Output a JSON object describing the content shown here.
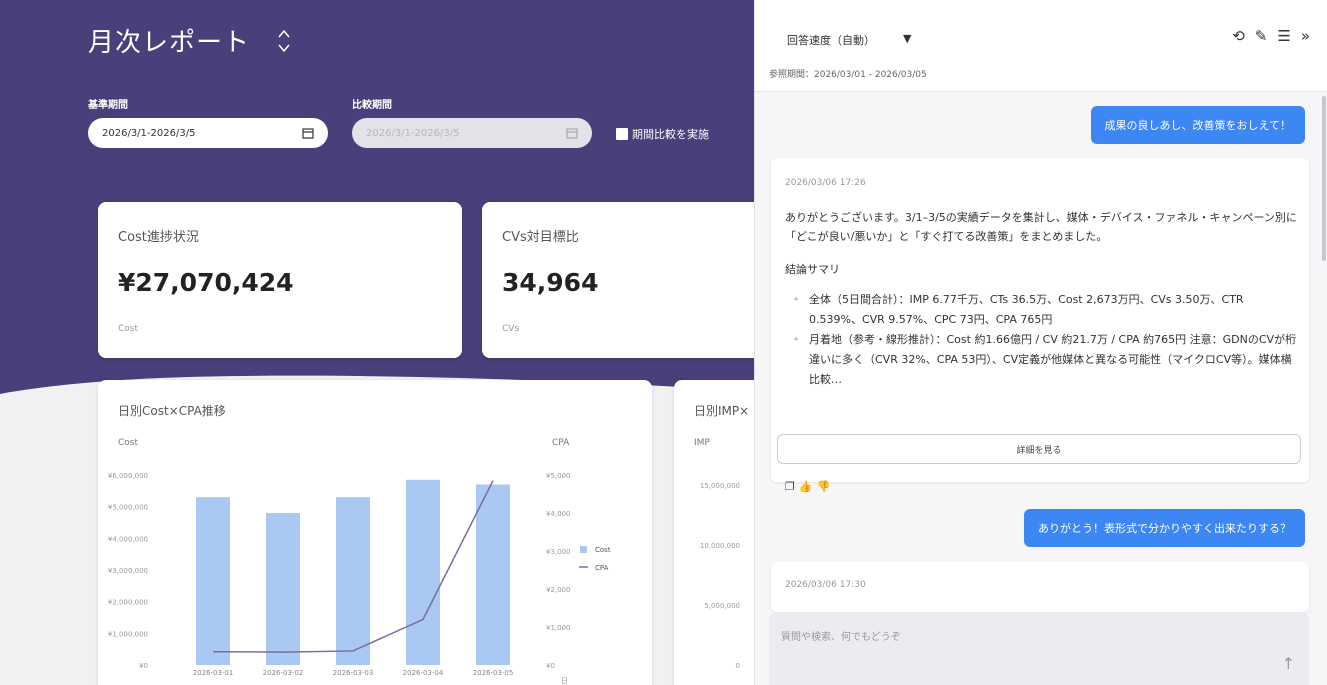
{
  "dashboard": {
    "title": "月次レポート",
    "base_period": {
      "label": "基準期間",
      "value": "2026/3/1-2026/3/5"
    },
    "compare_period": {
      "label": "比較期間",
      "value": "2026/3/1-2026/3/5"
    },
    "compare_checkbox_label": "期間比較を実施",
    "kpis": [
      {
        "title": "Cost進捗状況",
        "value": "¥27,070,424",
        "unit": "Cost"
      },
      {
        "title": "CVs対目標比",
        "value": "34,964",
        "unit": "CVs"
      }
    ],
    "cost_cpa_chart": {
      "title": "日別Cost×CPA推移",
      "left_axis_label": "Cost",
      "right_axis_label": "CPA",
      "right_axis_overflow_char": "日"
    },
    "imp_chart": {
      "title": "日別IMP×",
      "axis_label": "IMP"
    }
  },
  "chart_data": [
    {
      "type": "bar",
      "title": "日別Cost×CPA推移",
      "categories": [
        "2026-03-01",
        "2026-03-02",
        "2026-03-03",
        "2026-03-04",
        "2026-03-05"
      ],
      "y_left_label": "Cost",
      "y_left_ticks": [
        "¥0",
        "¥1,000,000",
        "¥2,000,000",
        "¥3,000,000",
        "¥4,000,000",
        "¥5,000,000",
        "¥6,000,000"
      ],
      "y_left_lim": [
        0,
        6000000
      ],
      "y_right_label": "CPA",
      "y_right_ticks": [
        "¥0",
        "¥1,000",
        "¥2,000",
        "¥3,000",
        "¥4,000",
        "¥5,000"
      ],
      "y_right_lim": [
        0,
        5000
      ],
      "series": [
        {
          "name": "Cost",
          "type": "bar",
          "axis": "left",
          "color": "#a9c8f2",
          "values": [
            5300000,
            4800000,
            5300000,
            5850000,
            5700000
          ]
        },
        {
          "name": "CPA",
          "type": "line",
          "axis": "right",
          "color": "#7d6aa6",
          "values": [
            350,
            340,
            370,
            1200,
            4850
          ]
        }
      ],
      "legend": "right"
    },
    {
      "type": "bar",
      "title": "日別IMP×",
      "y_label": "IMP",
      "y_ticks": [
        "0",
        "5,000,000",
        "10,000,000",
        "15,000,000"
      ],
      "y_lim": [
        0,
        15000000
      ]
    }
  ],
  "chat": {
    "speed_select": {
      "label": "回答速度（自動）",
      "arrow": "▼"
    },
    "ref_period": "参照期間：2026/03/01 - 2026/03/05",
    "header_icons": [
      "history-icon",
      "edit-icon",
      "filter-icon",
      "collapse-icon"
    ],
    "messages": {
      "user_1": "成果の良しあし、改善策をおしえて！",
      "ai_1_time": "2026/03/06 17:26",
      "ai_1_intro": "ありがとうございます。3/1–3/5の実績データを集計し、媒体・デバイス・ファネル・キャンペーン別に「どこが良い/悪いか」と「すぐ打てる改善策」をまとめました。",
      "ai_1_summary_heading": "結論サマリ",
      "ai_1_bullet_1": "全体（5日間合計）：IMP 6.77千万、CTs 36.5万、Cost 2,673万円、CVs 3.50万、CTR 0.539%、CVR 9.57%、CPC 73円、CPA 765円",
      "ai_1_bullet_2": "月着地（参考・線形推計）：Cost 約1.66億円 / CV 約21.7万 / CPA 約765円 注意：GDNのCVが桁違いに多く（CVR 32%、CPA 53円）、CV定義が他媒体と異なる可能性（マイクロCV等）。媒体横比較…",
      "detail_button": "詳細を見る",
      "user_2": "ありがとう！表形式で分かりやすく出来たりする？",
      "ai_2_time": "2026/03/06 17:30"
    },
    "input_placeholder": "質問や検索、何でもどうぞ"
  }
}
